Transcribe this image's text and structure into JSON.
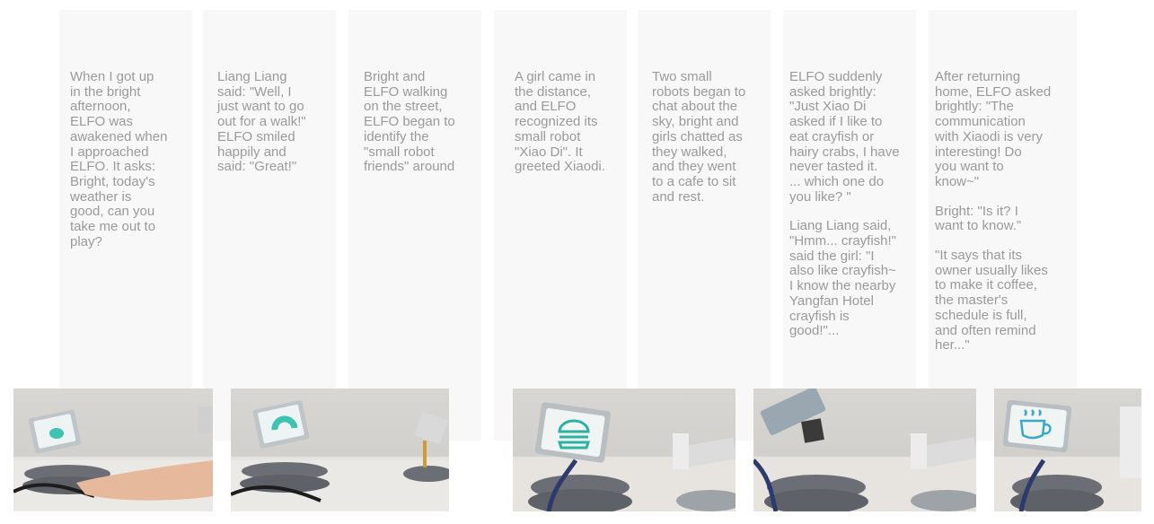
{
  "story_cards": [
    {
      "paragraphs": [
        "When I got up\nin the bright\nafternoon,\nELFO was\nawakened when\nI approached\nELFO. It asks:\nBright, today's\nweather is\ngood, can you\ntake me out to\nplay?"
      ]
    },
    {
      "paragraphs": [
        "Liang Liang\nsaid: \"Well, I\njust want to go\nout for a walk!\"\nELFO smiled\nhappily and\nsaid: \"Great!\""
      ]
    },
    {
      "paragraphs": [
        "Bright and\nELFO walking\non the street,\nELFO began to\nidentify the\n\"small robot\nfriends\" around"
      ]
    },
    {
      "paragraphs": [
        "A girl came in\nthe distance,\nand ELFO\nrecognized its\nsmall robot\n\"Xiao Di\". It\ngreeted Xiaodi."
      ]
    },
    {
      "paragraphs": [
        "Two small\nrobots began to\nchat about the\nsky, bright and\ngirls chatted as\nthey walked,\nand they went\nto a cafe to sit\nand rest."
      ]
    },
    {
      "paragraphs": [
        "ELFO suddenly\nasked brightly:\n\"Just Xiao Di\nasked if I like to\neat crayfish or\nhairy crabs, I have\nnever tasted it.\n... which one do\nyou like? \"",
        "Liang Liang said,\n\"Hmm... crayfish!\"\nsaid the girl: \"I\nalso like crayfish~\nI know the nearby\nYangfan Hotel\ncrayfish is\ngood!\"..."
      ]
    },
    {
      "paragraphs": [
        "After returning\nhome, ELFO asked\nbrightly: \"The\ncommunication\nwith Xiaodi is very\ninteresting! Do\nyou want to\nknow~\"",
        "Bright: \"Is it? I\nwant to know.\"",
        "\"It says that its\nowner usually likes\nto make it coffee,\nthe master's\nschedule is full,\nand often remind\nher...\""
      ]
    }
  ],
  "photos": [
    {
      "screen_icon": "smile-face-icon",
      "screen_color": "#3dc3b3",
      "scene": "hand-near-robot"
    },
    {
      "screen_icon": "arc-eye-icon",
      "screen_color": "#3dc3b3",
      "scene": "robot-facing-robot"
    },
    {
      "screen_icon": "burger-icon",
      "screen_color": "#2bb3a0",
      "scene": "robot-with-burger-screen"
    },
    {
      "screen_icon": "none",
      "screen_color": "#9aa7b0",
      "scene": "robots-chatting"
    },
    {
      "screen_icon": "coffee-cup-icon",
      "screen_color": "#3aa8c8",
      "scene": "robot-with-coffee-screen"
    }
  ]
}
